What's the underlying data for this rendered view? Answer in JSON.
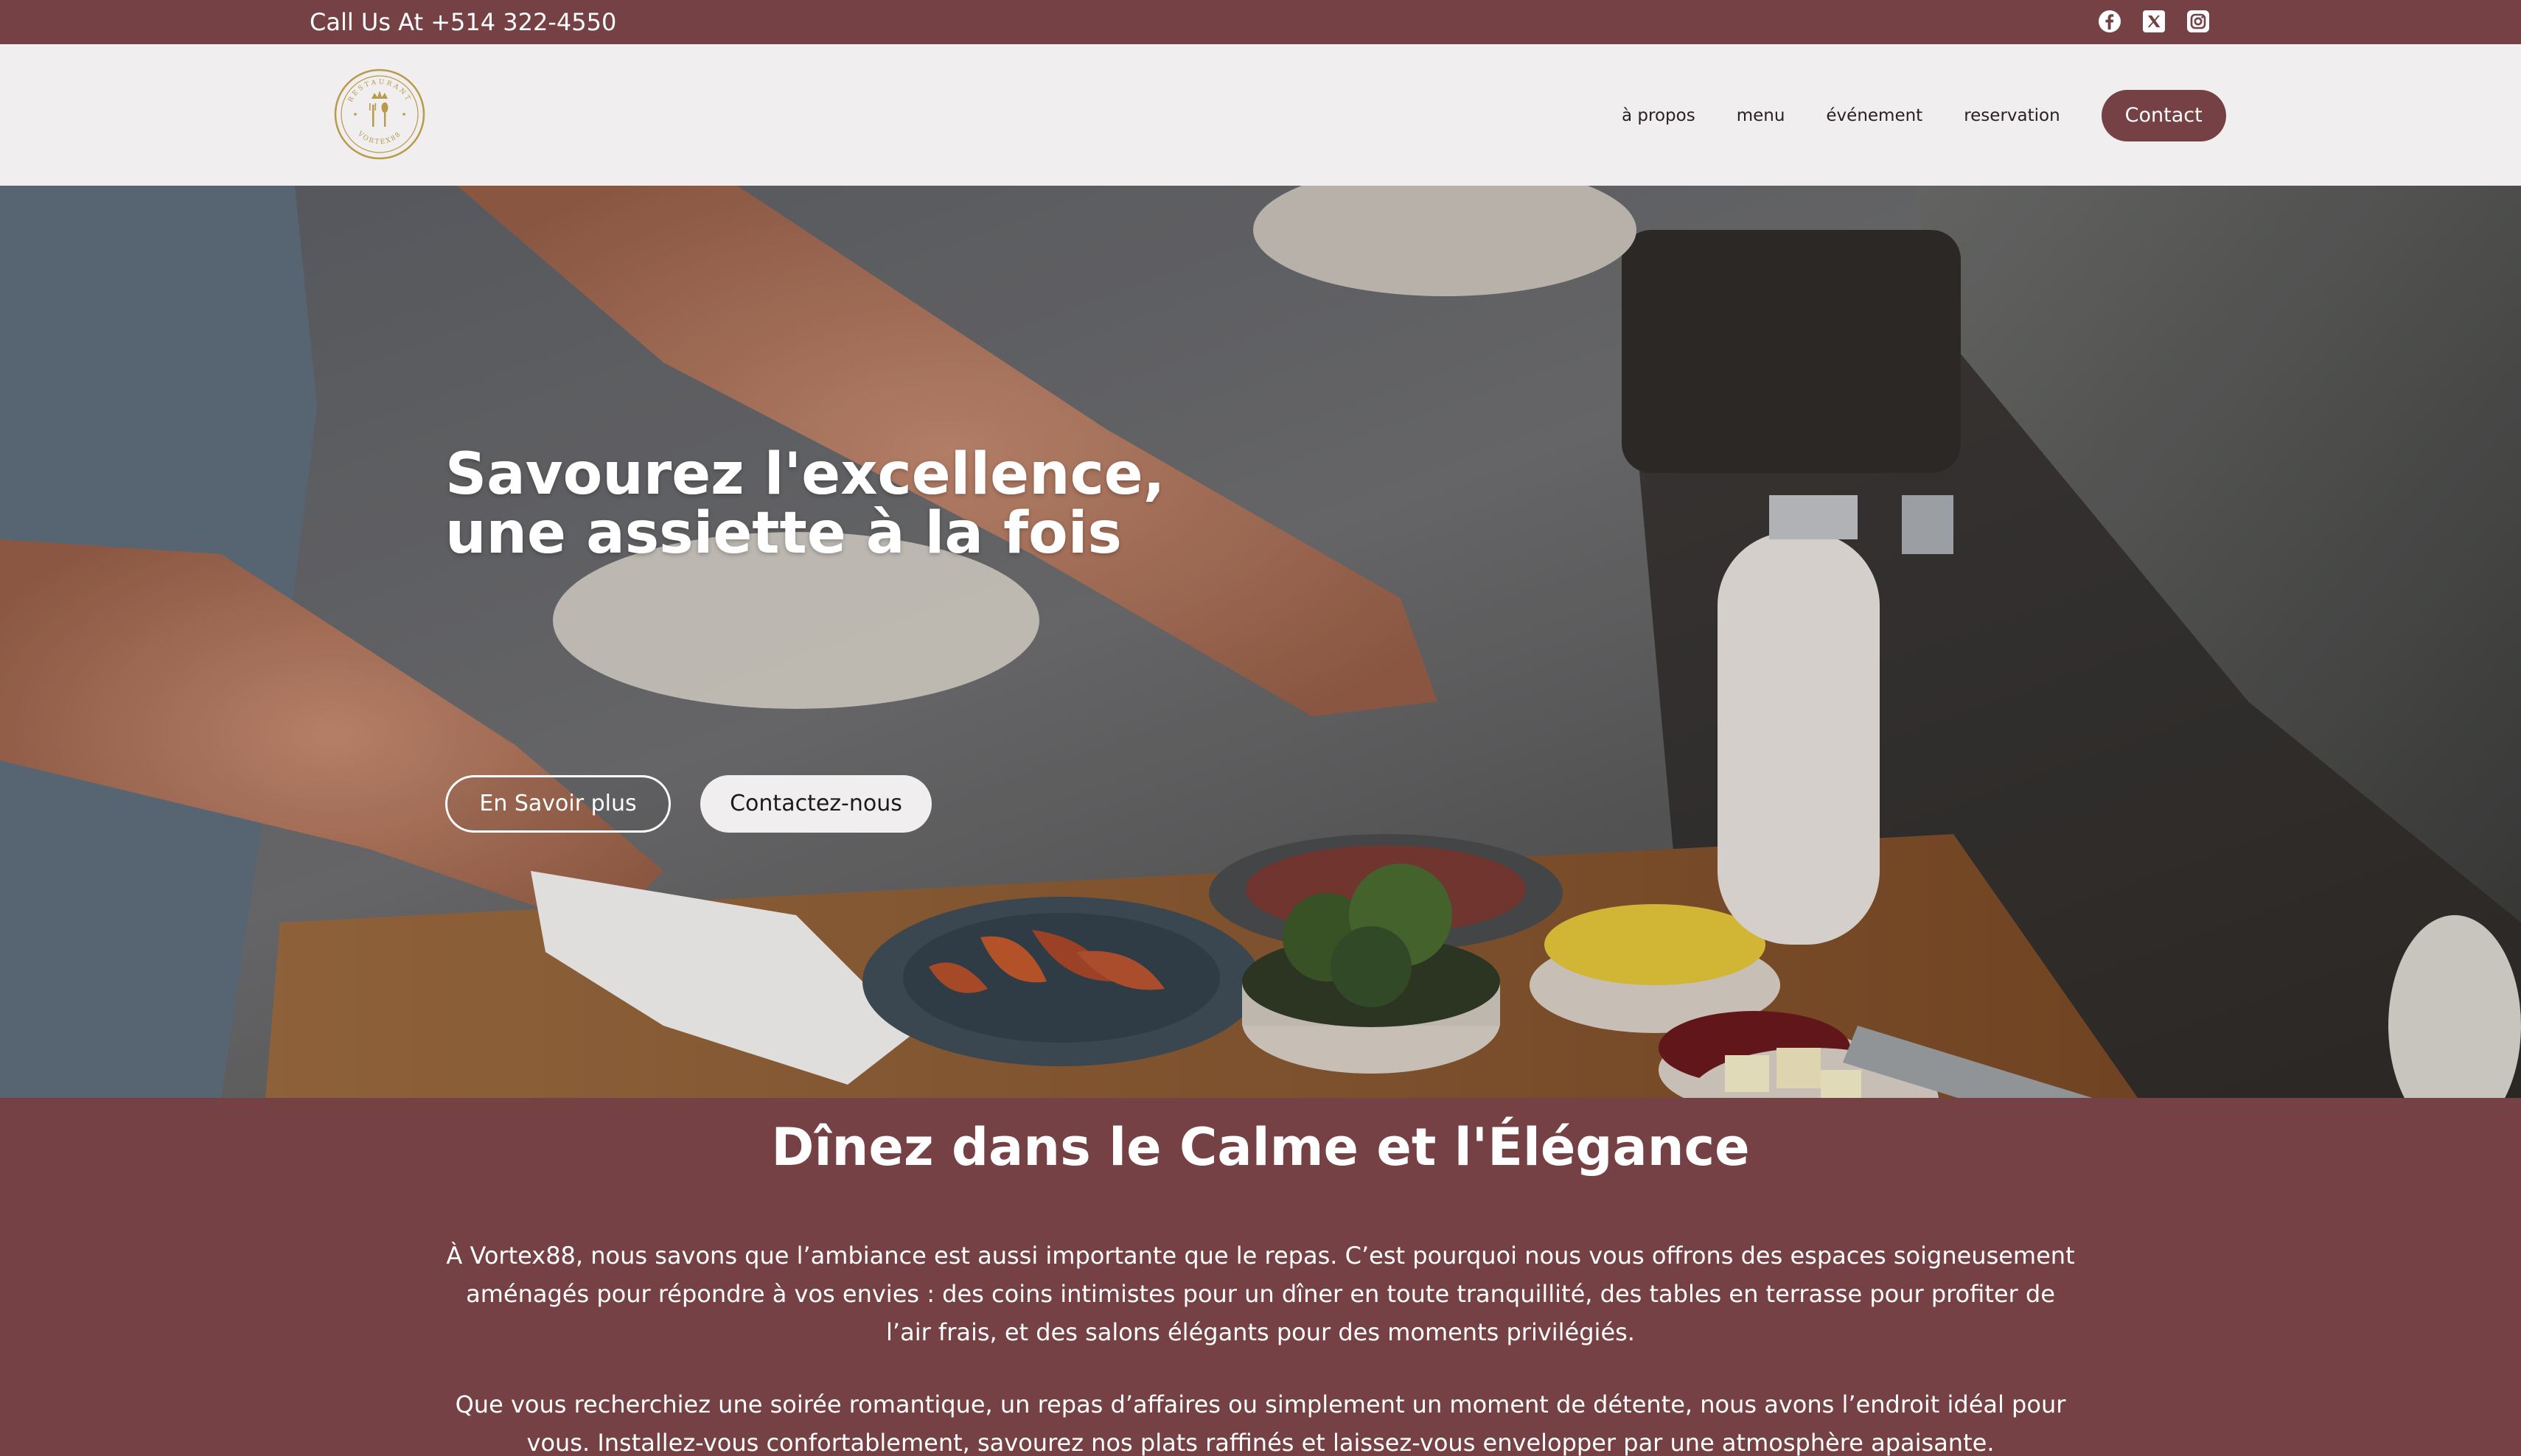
{
  "topbar": {
    "phone": "Call Us At +514 322-4550",
    "social": [
      "facebook-icon",
      "x-twitter-icon",
      "instagram-icon"
    ]
  },
  "header": {
    "logo": {
      "arc_text": "RESTAURANT",
      "name": "VORTEX88"
    },
    "nav": {
      "items": [
        "à propos",
        "menu",
        "événement",
        "reservation"
      ],
      "contact_label": "Contact"
    }
  },
  "hero": {
    "title": "Savourez l'excellence, une assiette à la fois",
    "btn_more": "En Savoir plus",
    "btn_contact": "Contactez-nous"
  },
  "section": {
    "title": "Dînez dans le Calme et l'Élégance",
    "p1": "À Vortex88, nous savons que l’ambiance est aussi importante que le repas. C’est pourquoi nous vous offrons des espaces soigneusement aménagés pour répondre à vos envies : des coins intimistes pour un dîner en toute tranquillité, des tables en terrasse pour profiter de l’air frais, et des salons élégants pour des moments privilégiés.",
    "p2": "Que vous recherchiez une soirée romantique, un repas d’affaires ou simplement un moment de détente, nous avons l’endroit idéal pour vous. Installez-vous confortablement, savourez nos plats raffinés et laissez-vous envelopper par une atmosphère apaisante."
  },
  "colors": {
    "brand": "#754144",
    "header_bg": "#f0eeef",
    "logo_gold": "#b89a4a"
  }
}
